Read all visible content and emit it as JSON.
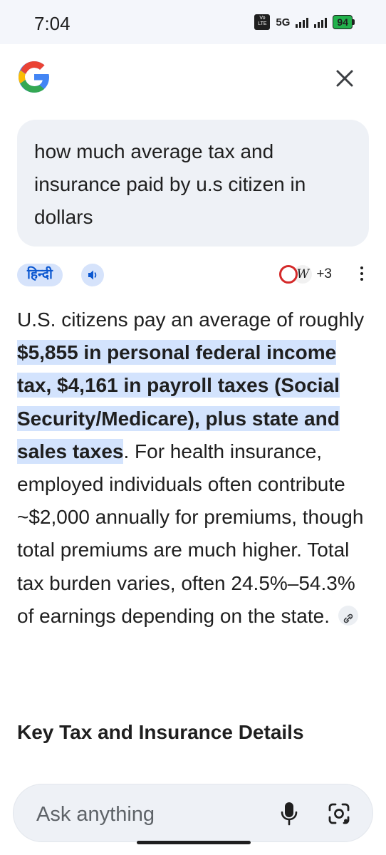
{
  "status_bar": {
    "time": "7:04",
    "volte_top": "Vo",
    "volte_bottom": "LTE",
    "network": "5G",
    "battery": "94"
  },
  "header": {
    "logo_icon": "google-g-icon",
    "close_icon": "close-icon"
  },
  "query": {
    "text": "how much average tax and insurance paid by u.s citizen in dollars"
  },
  "toolbar": {
    "language_label": "हिन्दी",
    "speak_icon": "speaker-icon",
    "sources_count": "+3",
    "more_icon": "more-vert-icon"
  },
  "answer": {
    "intro": "U.S. citizens pay an average of roughly ",
    "highlight": "$5,855 in personal federal income tax, $4,161 in payroll taxes (Social Security/Medicare), plus state and sales taxes",
    "rest": ". For health insurance, employed individuals often contribute ~$2,000 annually for premiums, though total premiums are much higher. Total tax burden varies, often 24.5%–54.3% of earnings depending on the state.",
    "link_icon": "link-icon"
  },
  "section": {
    "heading": "Key Tax and Insurance Details"
  },
  "ask_bar": {
    "placeholder": "Ask anything",
    "mic_icon": "mic-icon",
    "lens_icon": "google-lens-icon"
  },
  "colors": {
    "highlight": "#d3e3fd",
    "chip_bg": "#d6e3fb",
    "chip_text": "#0b57d0",
    "bubble_bg": "#eef1f6",
    "battery": "#22b14c"
  }
}
